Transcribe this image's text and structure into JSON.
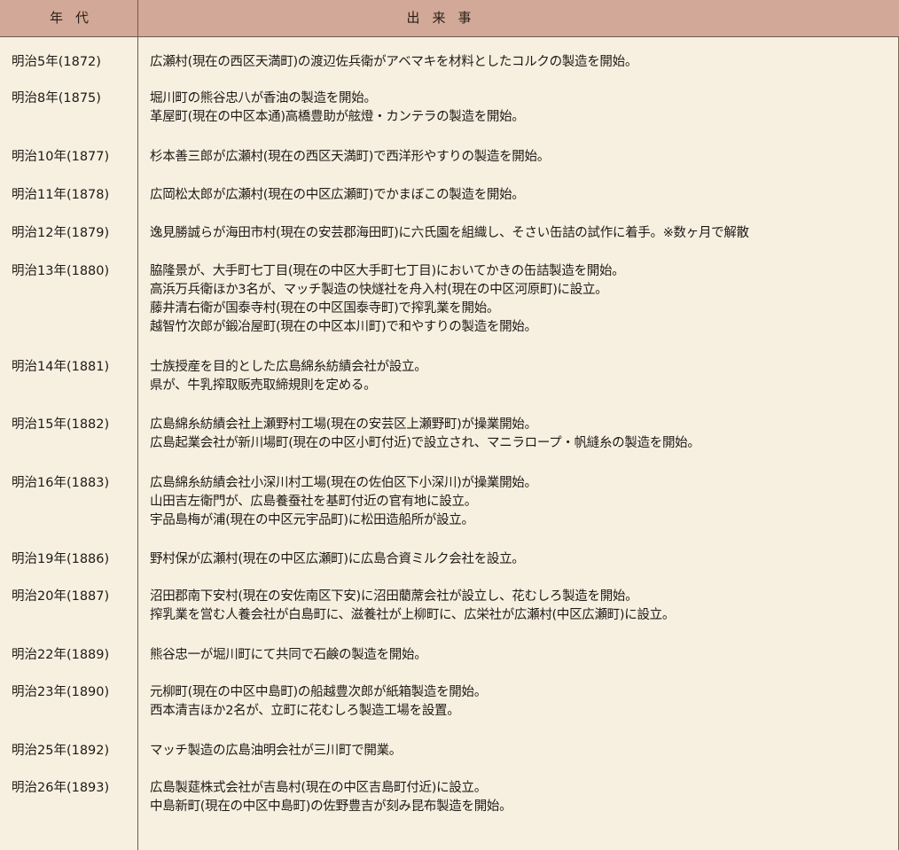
{
  "header": {
    "year_label": "年代",
    "event_label": "出来事"
  },
  "rows": [
    {
      "year": "明治5年(1872)",
      "events": [
        "広瀬村(現在の西区天満町)の渡辺佐兵衛がアベマキを材料としたコルクの製造を開始。"
      ]
    },
    {
      "year": "明治8年(1875)",
      "events": [
        "堀川町の熊谷忠八が香油の製造を開始。",
        "革屋町(現在の中区本通)高橋豊助が舷燈・カンテラの製造を開始。"
      ]
    },
    {
      "year": "明治10年(1877)",
      "events": [
        "杉本善三郎が広瀬村(現在の西区天満町)で西洋形やすりの製造を開始。"
      ]
    },
    {
      "year": "明治11年(1878)",
      "events": [
        "広岡松太郎が広瀬村(現在の中区広瀬町)でかまぼこの製造を開始。"
      ]
    },
    {
      "year": "明治12年(1879)",
      "events": [
        "逸見勝誠らが海田市村(現在の安芸郡海田町)に六氏園を組織し、そさい缶詰の試作に着手。※数ヶ月で解散"
      ]
    },
    {
      "year": "明治13年(1880)",
      "events": [
        "脇隆景が、大手町七丁目(現在の中区大手町七丁目)においてかきの缶詰製造を開始。",
        "高浜万兵衛ほか3名が、マッチ製造の快燧社を舟入村(現在の中区河原町)に設立。",
        "藤井清右衛が国泰寺村(現在の中区国泰寺町)で搾乳業を開始。",
        "越智竹次郎が鍛冶屋町(現在の中区本川町)で和やすりの製造を開始。"
      ]
    },
    {
      "year": "明治14年(1881)",
      "events": [
        "士族授産を目的とした広島綿糸紡績会社が設立。",
        "県が、牛乳搾取販売取締規則を定める。"
      ]
    },
    {
      "year": "明治15年(1882)",
      "events": [
        "広島綿糸紡績会社上瀬野村工場(現在の安芸区上瀬野町)が操業開始。",
        "広島起業会社が新川場町(現在の中区小町付近)で設立され、マニラロープ・帆縫糸の製造を開始。"
      ]
    },
    {
      "year": "明治16年(1883)",
      "events": [
        "広島綿糸紡績会社小深川村工場(現在の佐伯区下小深川)が操業開始。",
        "山田吉左衛門が、広島養蚕社を基町付近の官有地に設立。",
        "宇品島梅が浦(現在の中区元宇品町)に松田造船所が設立。"
      ]
    },
    {
      "year": "明治19年(1886)",
      "events": [
        "野村保が広瀬村(現在の中区広瀬町)に広島合資ミルク会社を設立。"
      ]
    },
    {
      "year": "明治20年(1887)",
      "events": [
        "沼田郡南下安村(現在の安佐南区下安)に沼田藺蓆会社が設立し、花むしろ製造を開始。",
        "搾乳業を営む人養会社が白島町に、滋養社が上柳町に、広栄社が広瀬村(中区広瀬町)に設立。"
      ]
    },
    {
      "year": "明治22年(1889)",
      "events": [
        "熊谷忠一が堀川町にて共同で石鹸の製造を開始。"
      ]
    },
    {
      "year": "明治23年(1890)",
      "events": [
        "元柳町(現在の中区中島町)の船越豊次郎が紙箱製造を開始。",
        "西本清吉ほか2名が、立町に花むしろ製造工場を設置。"
      ]
    },
    {
      "year": "明治25年(1892)",
      "events": [
        "マッチ製造の広島油明会社が三川町で開業。"
      ]
    },
    {
      "year": "明治26年(1893)",
      "events": [
        "広島製莚株式会社が吉島村(現在の中区吉島町付近)に設立。",
        "中島新町(現在の中区中島町)の佐野豊吉が刻み昆布製造を開始。"
      ]
    }
  ]
}
